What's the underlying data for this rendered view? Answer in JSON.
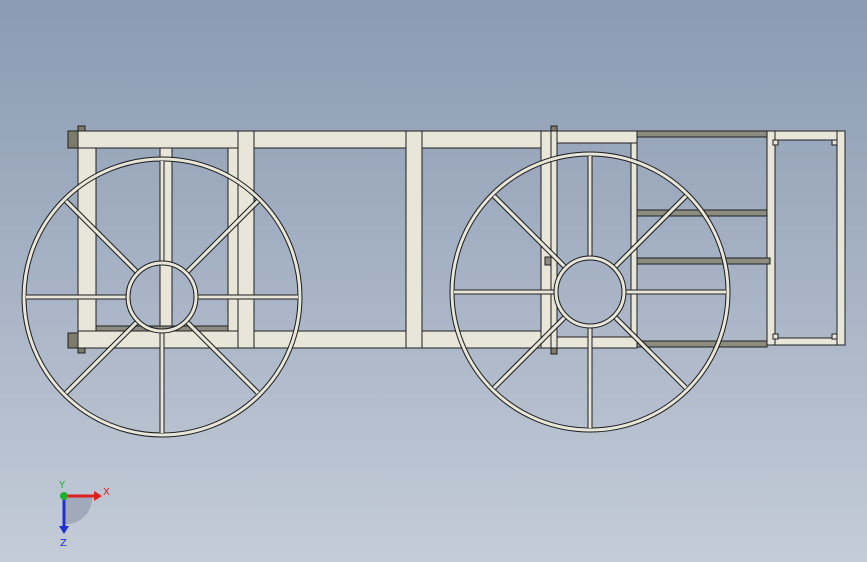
{
  "viewport": {
    "background_top": "#8b9bb2",
    "background_bottom": "#c4ccd8"
  },
  "model": {
    "frame_fill": "#e7e6d8",
    "frame_stroke": "#1f1f1f",
    "rail_dark": "#8c8c80",
    "wheel_stroke": "#1f1f1f",
    "wheel_fill": "#e7e6d8"
  },
  "triad": {
    "x_label": "X",
    "y_label": "Y",
    "z_label": "Z",
    "x_color": "#e02020",
    "y_color": "#20b030",
    "z_color": "#2030d0"
  }
}
